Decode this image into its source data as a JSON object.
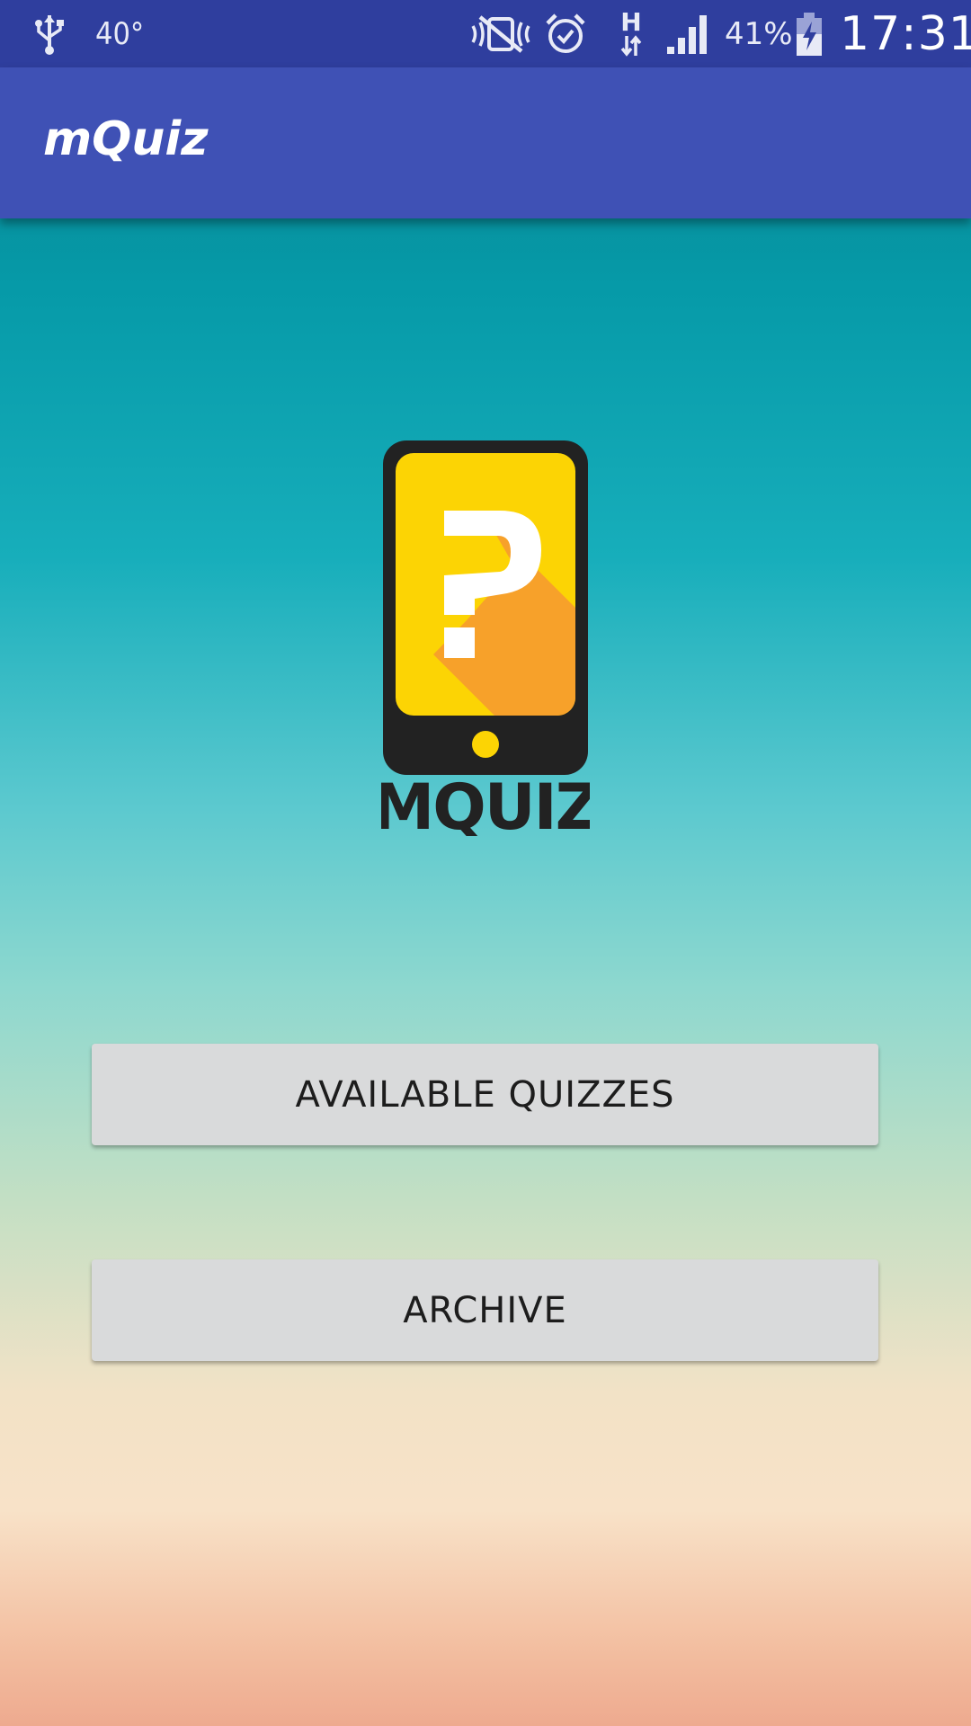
{
  "status_bar": {
    "temperature": "40°",
    "battery_percent": "41%",
    "network_type": "H",
    "time": "17:31",
    "icons": [
      "usb-icon",
      "mute-icon",
      "alarm-icon",
      "network-type-icon",
      "signal-icon",
      "battery-charging-icon"
    ]
  },
  "app_bar": {
    "title": "mQuiz"
  },
  "logo": {
    "wordmark": "MQUIZ",
    "colors": {
      "frame": "#222222",
      "screen": "#fcd404",
      "shadow": "#f7a12a",
      "question_mark": "#ffffff"
    }
  },
  "buttons": {
    "available_quizzes": "AVAILABLE QUIZZES",
    "archive": "ARCHIVE"
  },
  "colors": {
    "status_bar": "#2f3e9e",
    "app_bar": "#3f51b5",
    "button_bg": "#d9dadb"
  }
}
